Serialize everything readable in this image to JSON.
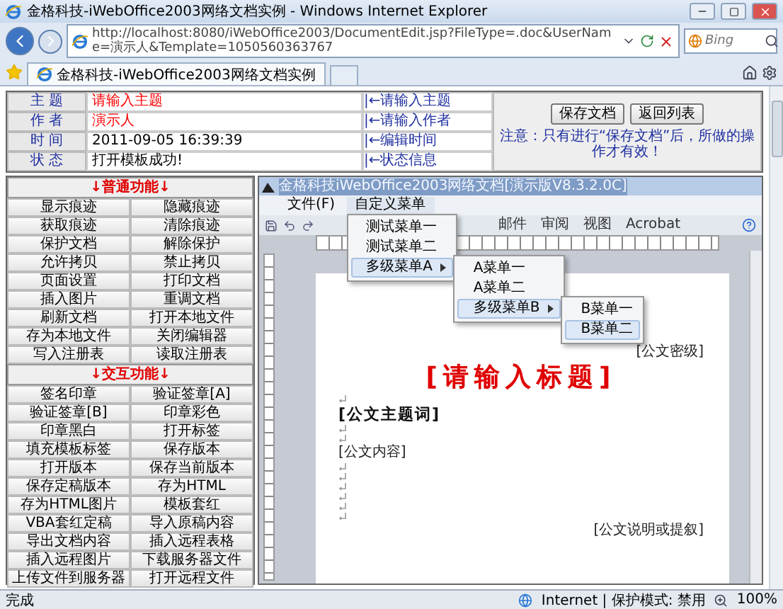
{
  "browser": {
    "title": "金格科技-iWebOffice2003网络文档实例 - Windows Internet Explorer",
    "address": "http://localhost:8080/iWebOffice2003/DocumentEdit.jsp?FileType=.doc&UserName=演示人&Template=1050560363767",
    "search": {
      "placeholder": "Bing"
    },
    "tabs": [
      {
        "label": "金格科技-iWebOffice2003网络文档实例",
        "selected": true
      }
    ]
  },
  "header": {
    "fields": [
      {
        "label": "主 题",
        "value": "请输入主题",
        "color": "#ff0000",
        "hint": "|←请输入主题"
      },
      {
        "label": "作 者",
        "value": "演示人",
        "color": "#ff0000",
        "hint": "|←请输入作者"
      },
      {
        "label": "时 间",
        "value": "2011-09-05 16:39:39",
        "color": "#000000",
        "hint": "|←编辑时间"
      },
      {
        "label": "状 态",
        "value": "打开模板成功!",
        "color": "#000000",
        "hint": "|←状态信息"
      }
    ],
    "buttons": [
      "保存文档",
      "返回列表"
    ],
    "note": "注意：只有进行“保存文档”后，所做的操作才有效！"
  },
  "sidebar": {
    "sections": [
      {
        "title": "↓普通功能↓",
        "items": [
          "显示痕迹",
          "隐藏痕迹",
          "获取痕迹",
          "清除痕迹",
          "保护文档",
          "解除保护",
          "允许拷贝",
          "禁止拷贝",
          "页面设置",
          "打印文档",
          "插入图片",
          "重调文档",
          "刷新文档",
          "打开本地文件",
          "存为本地文件",
          "关闭编辑器",
          "写入注册表",
          "读取注册表"
        ]
      },
      {
        "title": "↓交互功能↓",
        "items": [
          "签名印章",
          "验证签章[A]",
          "验证签章[B]",
          "印章彩色",
          "印章黑白",
          "打开标签",
          "填充模板标签",
          "保存版本",
          "打开版本",
          "保存当前版本",
          "保存定稿版本",
          "存为HTML",
          "存为HTML图片",
          "模板套红",
          "VBA套红定稿",
          "导入原稿内容",
          "导出文档内容",
          "插入远程表格",
          "插入远程图片",
          "下载服务器文件",
          "上传文件到服务器",
          "打开远程文件"
        ]
      }
    ]
  },
  "office": {
    "title": "金格科技iWebOffice2003网络文档[演示版V8.3.2.0C]",
    "menus": [
      {
        "label": "文件(F)",
        "expanded": false
      },
      {
        "label": "自定义菜单",
        "expanded": true,
        "children": [
          {
            "label": "测试菜单一",
            "selected": false
          },
          {
            "label": "测试菜单二",
            "selected": false
          },
          {
            "label": "多级菜单A",
            "selected": true,
            "expanded": true,
            "children": [
              {
                "label": "A菜单一",
                "selected": false
              },
              {
                "label": "A菜单二",
                "selected": false
              },
              {
                "label": "多级菜单B",
                "selected": true,
                "expanded": true,
                "children": [
                  {
                    "label": "B菜单一",
                    "selected": false
                  },
                  {
                    "label": "B菜单二",
                    "selected": true
                  }
                ]
              }
            ]
          }
        ]
      }
    ],
    "ribbon_tabs": [
      "邮件",
      "审阅",
      "视图",
      "Acrobat"
    ],
    "document": {
      "lines": [
        {
          "kind": "right",
          "text": "[公文密级]"
        },
        {
          "kind": "title",
          "text": "[请输入标题]"
        },
        {
          "kind": "mark"
        },
        {
          "kind": "subject",
          "text": "[公文主题词]"
        },
        {
          "kind": "mark"
        },
        {
          "kind": "mark"
        },
        {
          "kind": "body",
          "text": "[公文内容]"
        },
        {
          "kind": "mark"
        },
        {
          "kind": "mark"
        },
        {
          "kind": "mark"
        },
        {
          "kind": "mark"
        },
        {
          "kind": "mark"
        },
        {
          "kind": "mark"
        },
        {
          "kind": "right",
          "text": "[公文说明或提叙]"
        }
      ]
    }
  },
  "status_bar": {
    "text": "完成",
    "zone": "Internet | 保护模式: 禁用",
    "zoom": "100%"
  }
}
